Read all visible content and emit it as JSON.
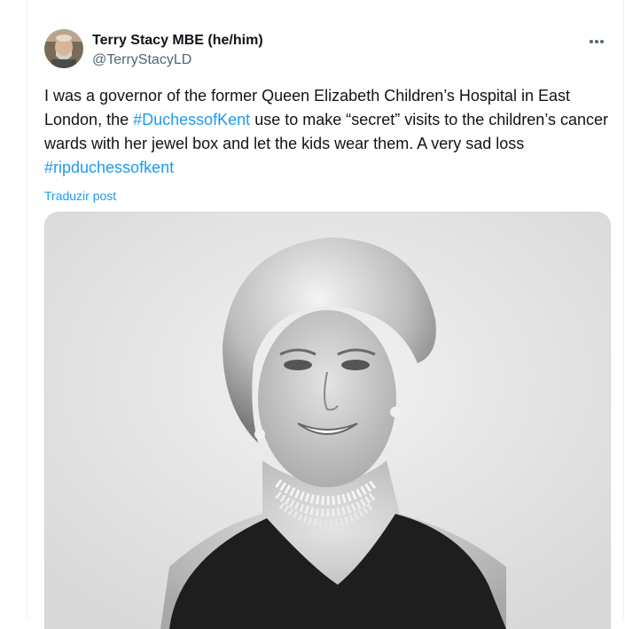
{
  "tweet": {
    "author": {
      "display_name": "Terry Stacy MBE (he/him)",
      "handle": "@TerryStacyLD"
    },
    "text": {
      "part1": "I was a governor of the former Queen Elizabeth Children’s Hospital in East London, the ",
      "hashtag1": "#DuchessofKent",
      "part2": " use to make “secret” visits to the children’s cancer wards with her jewel box and let the kids wear them.   A very sad loss ",
      "hashtag2": "#ripduchessofkent"
    },
    "translate_label": "Traduzir post",
    "more_icon": "more-horizontal-icon"
  },
  "colors": {
    "link": "#1d9bf0",
    "text": "#0f1419",
    "secondary": "#536471",
    "border": "#cfd9de"
  }
}
